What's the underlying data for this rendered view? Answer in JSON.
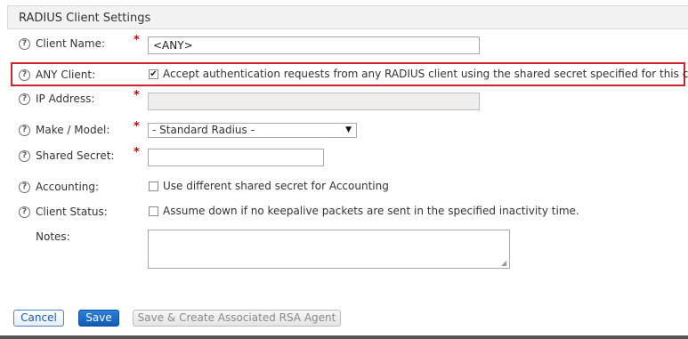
{
  "panel": {
    "title": "RADIUS Client Settings"
  },
  "fields": {
    "client_name": {
      "label": "Client Name:",
      "required": "*",
      "value": "<ANY>"
    },
    "any_client": {
      "label": "ANY Client:",
      "checked": true,
      "check_glyph": "✔",
      "text": "Accept authentication requests from any RADIUS client using the shared secret specified for this client"
    },
    "ip_address": {
      "label": "IP Address:",
      "required": "*",
      "value": ""
    },
    "make_model": {
      "label": "Make / Model:",
      "required": "*",
      "value": "- Standard Radius -"
    },
    "shared_secret": {
      "label": "Shared Secret:",
      "required": "*",
      "value": ""
    },
    "accounting": {
      "label": "Accounting:",
      "checked": false,
      "text": "Use different shared secret for Accounting"
    },
    "client_status": {
      "label": "Client Status:",
      "checked": false,
      "text": "Assume down if no keepalive packets are sent in the specified inactivity time."
    },
    "notes": {
      "label": "Notes:",
      "value": ""
    }
  },
  "help_glyph": "?",
  "icons": {
    "help": "help-circle-icon",
    "dropdown": "chevron-down-icon",
    "checkbox": "checkmark-icon"
  },
  "buttons": {
    "cancel": "Cancel",
    "save": "Save",
    "save_create_agent": "Save & Create Associated RSA Agent"
  },
  "colors": {
    "highlight": "#d3232b",
    "required": "#d00000",
    "primary": "#0f5cb8"
  }
}
